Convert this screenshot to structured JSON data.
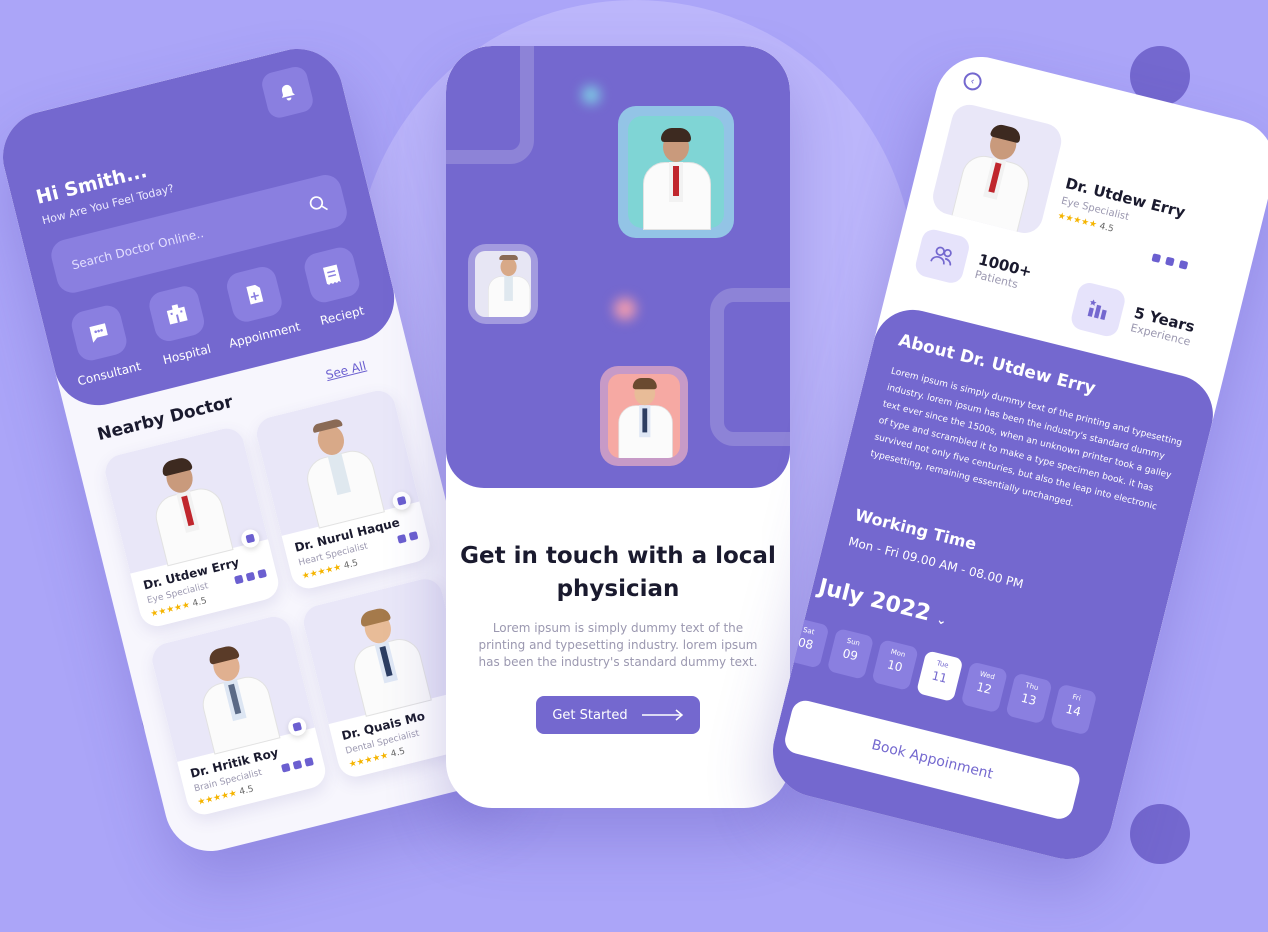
{
  "left": {
    "greeting": "Hi Smith...",
    "subtitle": "How Are You Feel Today?",
    "search_placeholder": "Search Doctor Online..",
    "categories": [
      {
        "label": "Consultant",
        "icon": "chat-icon"
      },
      {
        "label": "Hospital",
        "icon": "hospital-icon"
      },
      {
        "label": "Appoinment",
        "icon": "document-plus-icon"
      },
      {
        "label": "Reciept",
        "icon": "receipt-icon"
      }
    ],
    "see_all": "See All",
    "section_title": "Nearby Doctor",
    "doctors": [
      {
        "name": "Dr. Utdew Erry",
        "specialty": "Eye Specialist",
        "stars": "★★★★★",
        "rating": "4.5"
      },
      {
        "name": "Dr. Nurul Haque",
        "specialty": "Heart Specialist",
        "stars": "★★★★★",
        "rating": "4.5"
      },
      {
        "name": "Dr. Hritik Roy",
        "specialty": "Brain Specialist",
        "stars": "★★★★★",
        "rating": "4.5"
      },
      {
        "name": "Dr. Quais Mo",
        "specialty": "Dental Specialist",
        "stars": "★★★★★",
        "rating": "4.5"
      }
    ]
  },
  "middle": {
    "title_line1": "Get in touch with a local",
    "title_line2": "physician",
    "description": "Lorem ipsum is simply dummy text of the printing and typesetting industry. lorem ipsum has been the industry's standard dummy text.",
    "button": "Get Started"
  },
  "right": {
    "doctor_name": "Dr. Utdew Erry",
    "specialty": "Eye Specialist",
    "stars": "★★★★★",
    "rating": "4.5",
    "stats": [
      {
        "value": "1000+",
        "label": "Patients",
        "icon": "users-icon"
      },
      {
        "value": "5 Years",
        "label": "Experience",
        "icon": "chart-icon"
      }
    ],
    "about_title": "About Dr. Utdew Erry",
    "about_text": "Lorem ipsum is simply dummy text of the printing and typesetting industry. lorem ipsum has been the industry's standard dummy text ever since the 1500s, when an unknown printer took a galley of type and scrambled it to make a type specimen book. it has survived not only five centuries, but also the leap into electronic typesetting, remaining essentially unchanged.",
    "working_title": "Working Time",
    "working_hours": "Mon - Fri 09.00 AM - 08.00 PM",
    "month": "July 2022",
    "days": [
      {
        "dow": "Sat",
        "num": "08"
      },
      {
        "dow": "Sun",
        "num": "09"
      },
      {
        "dow": "Mon",
        "num": "10"
      },
      {
        "dow": "Tue",
        "num": "11"
      },
      {
        "dow": "Wed",
        "num": "12"
      },
      {
        "dow": "Thu",
        "num": "13"
      },
      {
        "dow": "Fri",
        "num": "14"
      }
    ],
    "selected_day": "11",
    "book_button": "Book Appoinment"
  },
  "colors": {
    "background": "#aba5f8",
    "primary": "#7468cf",
    "star": "#f5b400"
  }
}
